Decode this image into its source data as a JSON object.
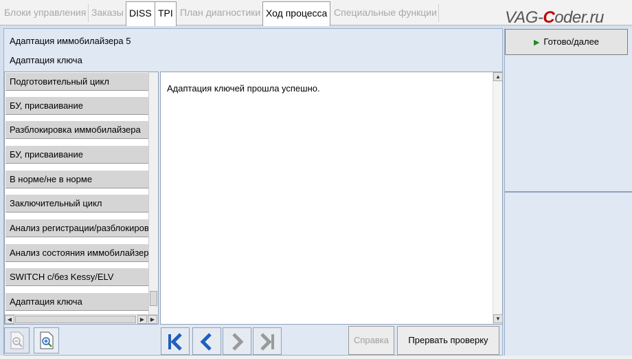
{
  "tabs": [
    {
      "label": "Блоки управления",
      "active": false
    },
    {
      "label": "Заказы",
      "active": false
    },
    {
      "label": "DISS",
      "active": true
    },
    {
      "label": "TPI",
      "active": true
    },
    {
      "label": "План диагностики",
      "active": false
    },
    {
      "label": "Ход процесса",
      "active": true
    },
    {
      "label": "Специальные функции",
      "active": false
    }
  ],
  "watermark": {
    "part1": "VAG-",
    "accent": "C",
    "part2": "oder.ru"
  },
  "header": {
    "title": "Адаптация иммобилайзера 5",
    "subtitle": "Адаптация ключа"
  },
  "steps": [
    "Подготовительный цикл",
    "БУ, присваивание",
    "Разблокировка иммобилайзера",
    "БУ, присваивание",
    "В норме/не в норме",
    "Заключительный цикл",
    "Анализ регистрации/разблокировки",
    "Анализ состояния иммобилайзера",
    "SWITCH с/без Kessy/ELV",
    "Адаптация ключа"
  ],
  "message": "Адаптация ключей прошла успешно.",
  "buttons": {
    "next": "Готово/далее",
    "help": "Справка",
    "abort": "Прервать проверку"
  },
  "icons": {
    "zoom_out": "zoom-out-page-icon",
    "zoom_in": "zoom-in-page-icon",
    "first": "skip-to-first-icon",
    "prev": "previous-icon",
    "next": "next-icon",
    "last": "skip-to-last-icon"
  },
  "colors": {
    "nav_active": "#1f5fbf",
    "nav_disabled": "#9a9a9a",
    "play": "#1c8c1c",
    "watermark_accent": "#c00000"
  }
}
